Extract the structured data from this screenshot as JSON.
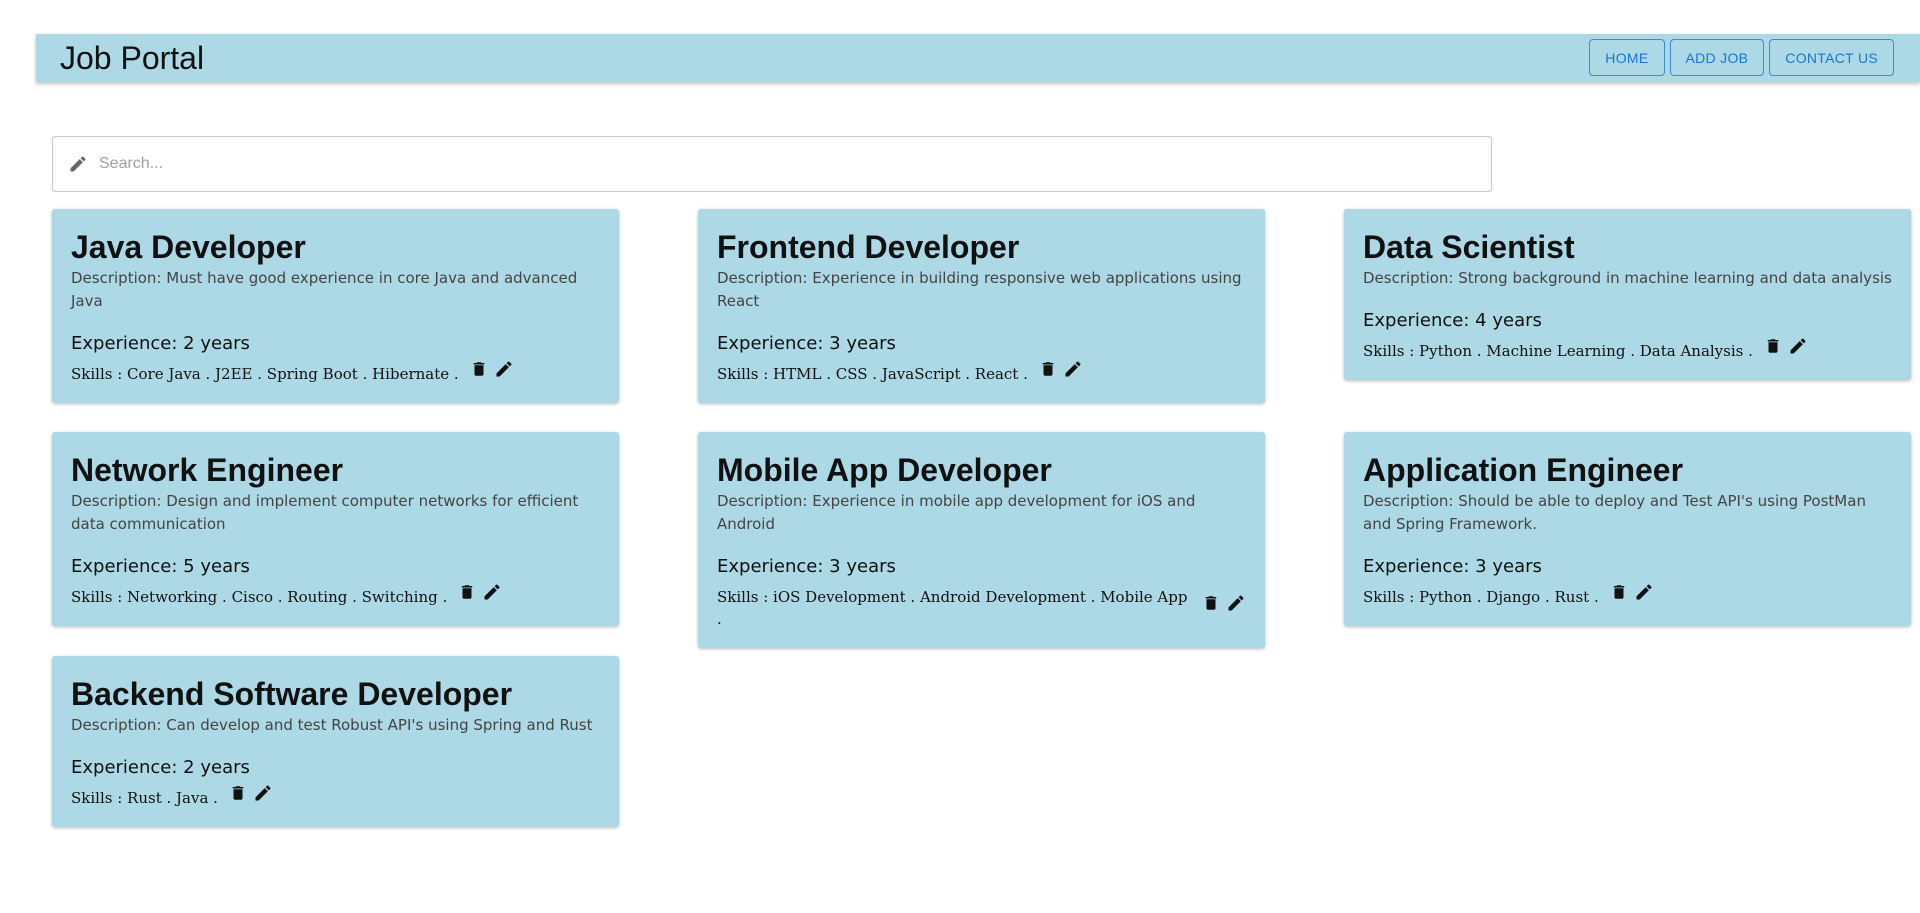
{
  "header": {
    "title": "Job Portal",
    "nav": [
      "HOME",
      "ADD JOB",
      "CONTACT US"
    ]
  },
  "search": {
    "placeholder": "Search...",
    "value": ""
  },
  "jobs": [
    {
      "title": "Java Developer",
      "description": "Description: Must have good experience in core Java and advanced Java",
      "experience": "Experience: 2 years",
      "skills": "Skills : Core Java . J2EE . Spring Boot . Hibernate ."
    },
    {
      "title": "Frontend Developer",
      "description": "Description: Experience in building responsive web applications using React",
      "experience": "Experience: 3 years",
      "skills": "Skills : HTML . CSS . JavaScript . React ."
    },
    {
      "title": "Data Scientist",
      "description": "Description: Strong background in machine learning and data analysis",
      "experience": "Experience: 4 years",
      "skills": "Skills : Python . Machine Learning . Data Analysis ."
    },
    {
      "title": "Network Engineer",
      "description": "Description: Design and implement computer networks for efficient data communication",
      "experience": "Experience: 5 years",
      "skills": "Skills : Networking . Cisco . Routing . Switching ."
    },
    {
      "title": "Mobile App Developer",
      "description": "Description: Experience in mobile app development for iOS and Android",
      "experience": "Experience: 3 years",
      "skills": "Skills : iOS Development . Android Development . Mobile App ."
    },
    {
      "title": "Application Engineer",
      "description": "Description: Should be able to deploy and Test API's using PostMan and Spring Framework.",
      "experience": "Experience: 3 years",
      "skills": "Skills : Python . Django . Rust ."
    },
    {
      "title": "Backend Software Developer",
      "description": "Description: Can develop and test Robust API's using Spring and Rust",
      "experience": "Experience: 2 years",
      "skills": "Skills : Rust . Java ."
    }
  ],
  "icons": {
    "search": "pencil-icon",
    "delete": "trash-icon",
    "edit": "pencil-icon"
  },
  "colors": {
    "card_background": "#add8e6",
    "header_background": "#add8e6",
    "nav_text": "#1976d2"
  }
}
